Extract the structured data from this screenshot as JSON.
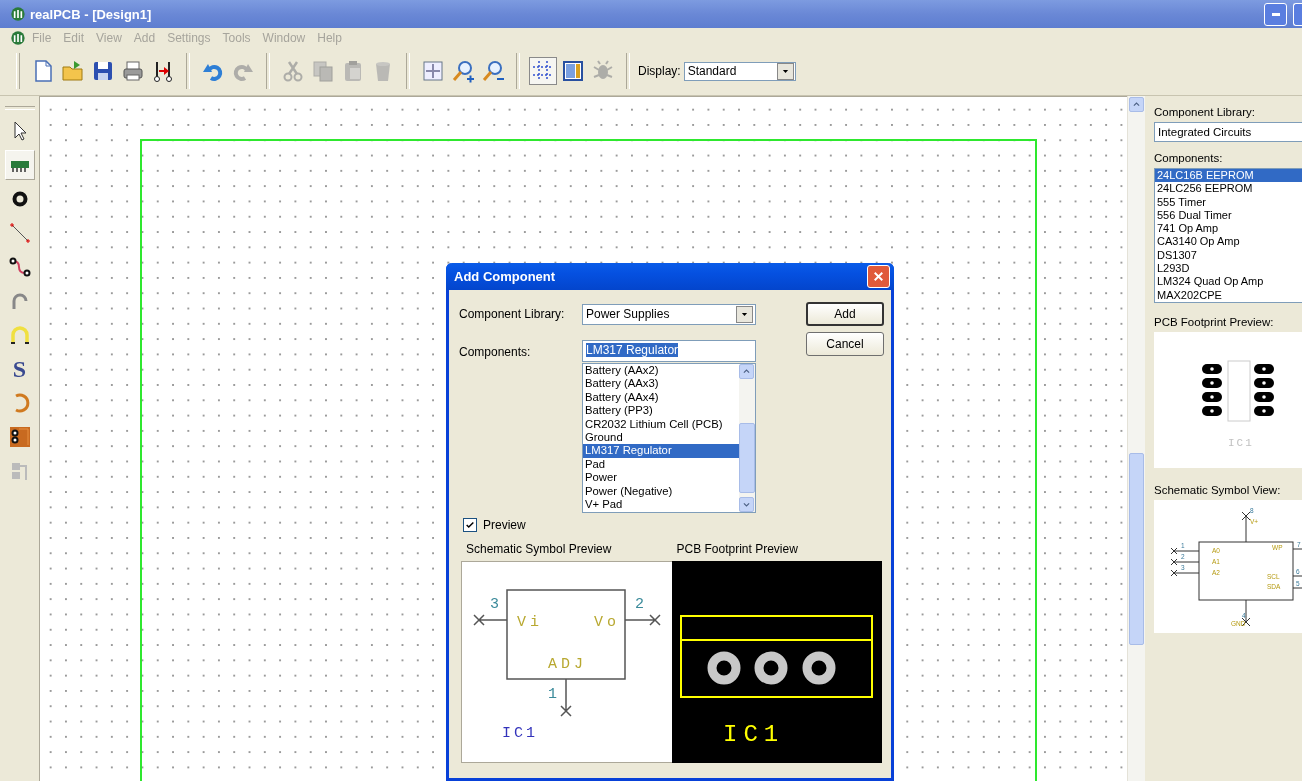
{
  "window": {
    "title": "realPCB - [Design1]"
  },
  "menu": [
    "File",
    "Edit",
    "View",
    "Add",
    "Settings",
    "Tools",
    "Window",
    "Help"
  ],
  "toolbar": {
    "buttons": [
      {
        "kind": "new",
        "disabled": false,
        "pressed": false
      },
      {
        "kind": "open",
        "disabled": false,
        "pressed": false
      },
      {
        "kind": "save",
        "disabled": false,
        "pressed": false
      },
      {
        "kind": "print",
        "disabled": false,
        "pressed": false
      },
      {
        "kind": "connect",
        "disabled": false,
        "pressed": false
      },
      {
        "kind": "separator"
      },
      {
        "kind": "undo",
        "disabled": false,
        "pressed": false
      },
      {
        "kind": "redo",
        "disabled": true,
        "pressed": false
      },
      {
        "kind": "separator"
      },
      {
        "kind": "cut",
        "disabled": true,
        "pressed": false
      },
      {
        "kind": "copy",
        "disabled": true,
        "pressed": false
      },
      {
        "kind": "paste",
        "disabled": true,
        "pressed": false
      },
      {
        "kind": "delete",
        "disabled": true,
        "pressed": false
      },
      {
        "kind": "separator"
      },
      {
        "kind": "fit",
        "disabled": false,
        "pressed": false
      },
      {
        "kind": "zoom-in",
        "disabled": false,
        "pressed": false
      },
      {
        "kind": "zoom-out",
        "disabled": false,
        "pressed": false
      },
      {
        "kind": "separator"
      },
      {
        "kind": "grid",
        "disabled": false,
        "pressed": true
      },
      {
        "kind": "layers",
        "disabled": false,
        "pressed": false
      },
      {
        "kind": "bug",
        "disabled": true,
        "pressed": false
      },
      {
        "kind": "separator"
      }
    ],
    "display_label": "Display:",
    "display_value": "Standard"
  },
  "tools": [
    {
      "kind": "pointer",
      "selected": false
    },
    {
      "kind": "chip",
      "selected": true
    },
    {
      "kind": "pad",
      "selected": false
    },
    {
      "kind": "line",
      "selected": false
    },
    {
      "kind": "track",
      "selected": false
    },
    {
      "kind": "arc",
      "selected": false
    },
    {
      "kind": "jumper",
      "selected": false
    },
    {
      "kind": "text",
      "glyph": "S",
      "selected": false
    },
    {
      "kind": "circle",
      "selected": false
    },
    {
      "kind": "copper",
      "selected": false
    },
    {
      "kind": "group",
      "selected": false
    }
  ],
  "side_panel": {
    "library_label": "Component Library:",
    "library_value": "Integrated Circuits",
    "components_label": "Components:",
    "components": [
      {
        "label": "24LC16B EEPROM",
        "selected": true
      },
      {
        "label": "24LC256 EEPROM",
        "selected": false
      },
      {
        "label": "555 Timer",
        "selected": false
      },
      {
        "label": "556 Dual Timer",
        "selected": false
      },
      {
        "label": "741 Op Amp",
        "selected": false
      },
      {
        "label": "CA3140 Op Amp",
        "selected": false
      },
      {
        "label": "DS1307",
        "selected": false
      },
      {
        "label": "L293D",
        "selected": false
      },
      {
        "label": "LM324 Quad Op Amp",
        "selected": false
      },
      {
        "label": "MAX202CPE",
        "selected": false
      }
    ],
    "footprint_label": "PCB Footprint Preview:",
    "footprint_ref": "IC1",
    "schematic_label": "Schematic Symbol View:",
    "schematic_pins": [
      {
        "number": "8",
        "name": "V+"
      },
      {
        "number": "1",
        "name": "A0"
      },
      {
        "number": "2",
        "name": "A1"
      },
      {
        "number": "3",
        "name": "A2"
      },
      {
        "number": "7",
        "name": "WP"
      },
      {
        "number": "6",
        "name": "SCL"
      },
      {
        "number": "5",
        "name": "SDA"
      },
      {
        "number": "4",
        "name": "GND"
      }
    ]
  },
  "dialog": {
    "title": "Add Component",
    "library_label": "Component Library:",
    "library_value": "Power Supplies",
    "components_label": "Components:",
    "components_value": "LM317 Regulator",
    "components": [
      {
        "label": "Battery (AAx2)",
        "selected": false
      },
      {
        "label": "Battery (AAx3)",
        "selected": false
      },
      {
        "label": "Battery (AAx4)",
        "selected": false
      },
      {
        "label": "Battery (PP3)",
        "selected": false
      },
      {
        "label": "CR2032 Lithium Cell (PCB)",
        "selected": false
      },
      {
        "label": "Ground",
        "selected": false
      },
      {
        "label": "LM317 Regulator",
        "selected": true
      },
      {
        "label": "Pad",
        "selected": false
      },
      {
        "label": "Power",
        "selected": false
      },
      {
        "label": "Power (Negative)",
        "selected": false
      },
      {
        "label": "V+ Pad",
        "selected": false
      }
    ],
    "buttons": [
      {
        "label": "Add",
        "default": true
      },
      {
        "label": "Cancel",
        "default": false
      }
    ],
    "preview": {
      "label": "Preview",
      "checked": true
    },
    "schematic_label": "Schematic Symbol Preview",
    "footprint_label": "PCB Footprint Preview",
    "schematic_pins": [
      {
        "number": "3",
        "name": "Vi"
      },
      {
        "number": "2",
        "name": "Vo"
      },
      {
        "number": "1",
        "name": "ADJ"
      }
    ],
    "schematic_ref": "IC1",
    "footprint_ref": "IC1"
  }
}
